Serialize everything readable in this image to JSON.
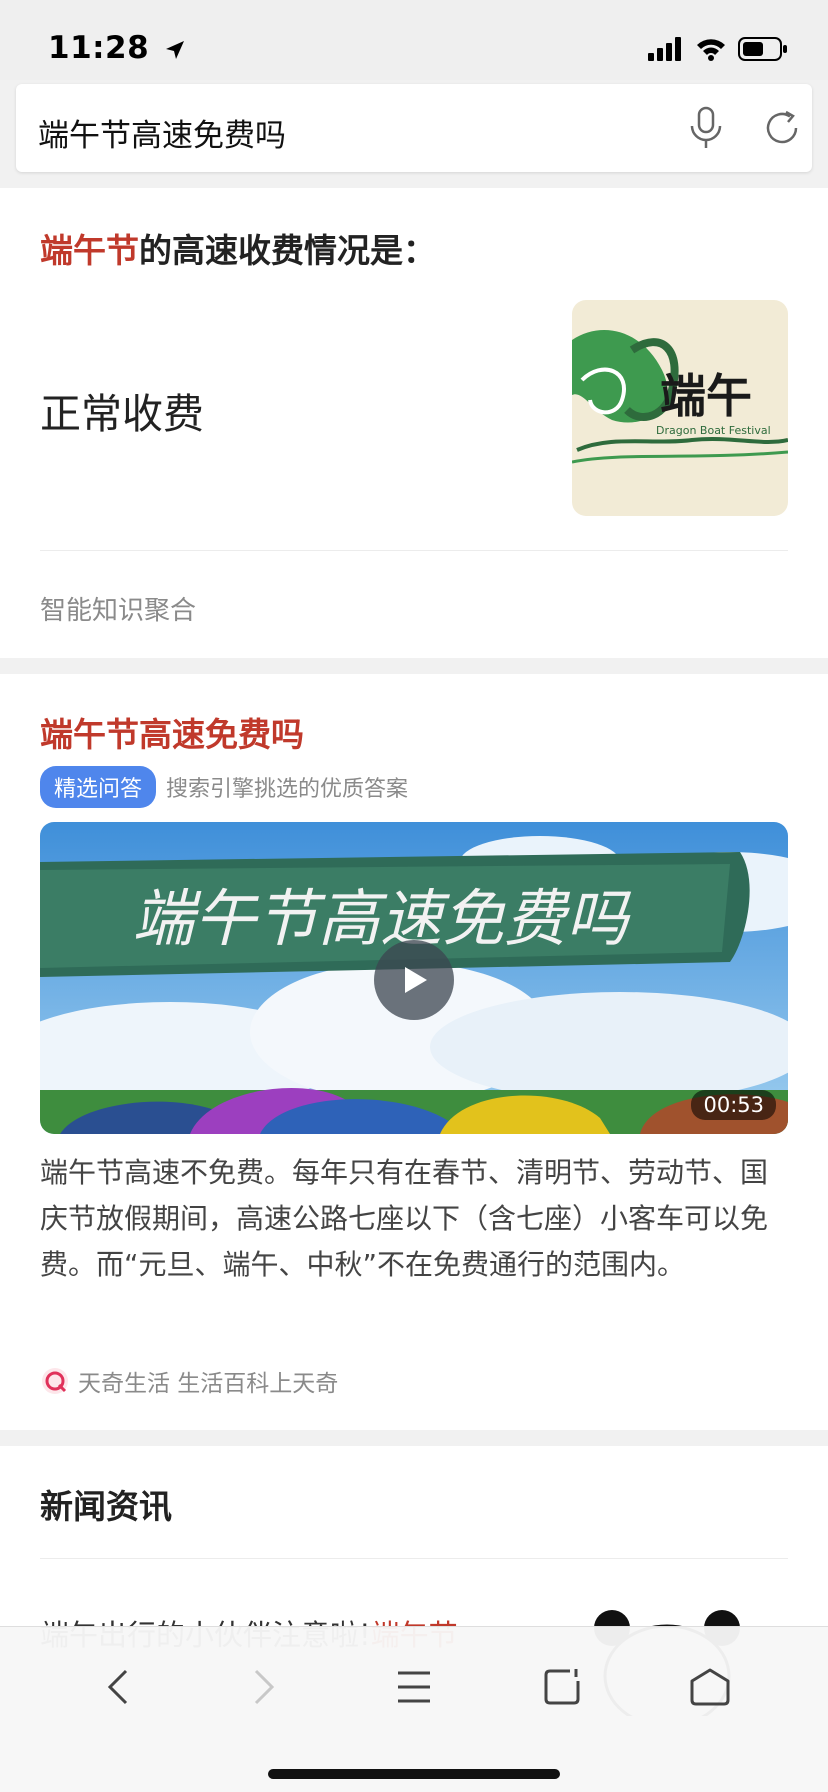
{
  "status_bar": {
    "time": "11:28"
  },
  "search": {
    "query": "端午节高速免费吗"
  },
  "answer_card": {
    "heading_highlight": "端午节",
    "heading_rest": "的高速收费情况是：",
    "value": "正常收费",
    "image_text": "端午",
    "image_subtext": "Dragon Boat Festival",
    "source": "智能知识聚合"
  },
  "result_card": {
    "title": "端午节高速免费吗",
    "badge": "精选问答",
    "badge_desc": "搜索引擎挑选的优质答案",
    "video_banner_text": "端午节高速免费吗",
    "video_duration": "00:53",
    "body": "端午节高速不免费。每年只有在春节、清明节、劳动节、国庆节放假期间，高速公路七座以下（含七座）小客车可以免费。而“元旦、端午、中秋”不在免费通行的范围内。",
    "source_name": "天奇生活 生活百科上天奇"
  },
  "news_card": {
    "header": "新闻资讯",
    "item_title_prefix": "端午出行的小伙伴注意啦!",
    "item_title_highlight": "端午节"
  },
  "colors": {
    "highlight": "#c0392b",
    "badge": "#4f86ec"
  },
  "icons": [
    "location-arrow-icon",
    "signal-icon",
    "wifi-icon",
    "battery-icon",
    "mic-icon",
    "refresh-icon",
    "play-icon",
    "back-icon",
    "forward-icon",
    "menu-icon",
    "tabs-icon",
    "home-icon"
  ]
}
